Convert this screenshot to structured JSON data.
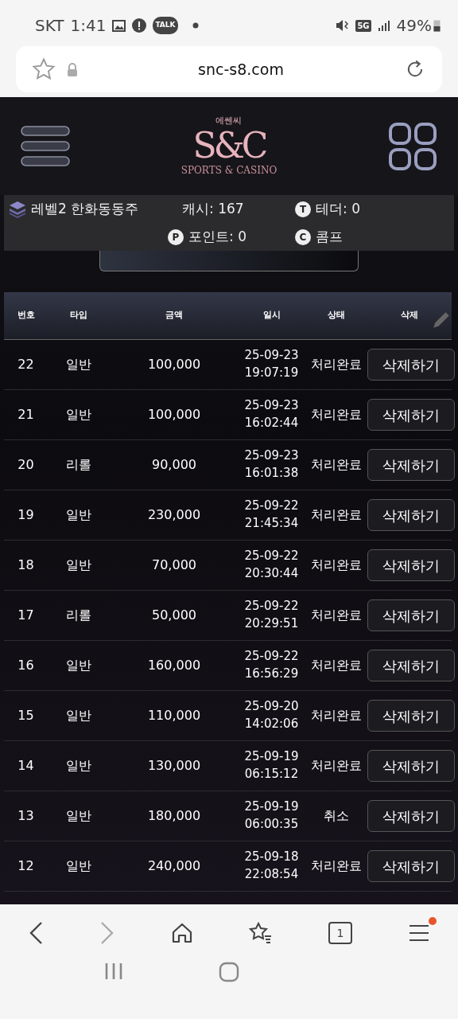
{
  "status_bar": {
    "carrier": "SKT",
    "time": "1:41",
    "talk_badge": "TALK",
    "network": "5G",
    "battery": "49%"
  },
  "address_bar": {
    "url": "snc-s8.com"
  },
  "header": {
    "logo": {
      "monogram": "S&C",
      "korean": "에쎈씨",
      "tagline": "SPORTS & CASINO"
    }
  },
  "user_info": {
    "level": "레벨2 한화동동주",
    "cash": "캐시: 167",
    "tether_badge": "T",
    "tether": "테더: 0",
    "points_badge": "P",
    "points": "포인트: 0",
    "comp_badge": "C",
    "comp": "콤프"
  },
  "table": {
    "columns": [
      "번호",
      "타입",
      "금액",
      "일시",
      "상태",
      "삭제"
    ],
    "rows": [
      {
        "no": "22",
        "type": "일반",
        "amount": "100,000",
        "date": "25-09-23",
        "time": "19:07:19",
        "status": "처리완료",
        "action": "삭제하기"
      },
      {
        "no": "21",
        "type": "일반",
        "amount": "100,000",
        "date": "25-09-23",
        "time": "16:02:44",
        "status": "처리완료",
        "action": "삭제하기"
      },
      {
        "no": "20",
        "type": "리롤",
        "amount": "90,000",
        "date": "25-09-23",
        "time": "16:01:38",
        "status": "처리완료",
        "action": "삭제하기"
      },
      {
        "no": "19",
        "type": "일반",
        "amount": "230,000",
        "date": "25-09-22",
        "time": "21:45:34",
        "status": "처리완료",
        "action": "삭제하기"
      },
      {
        "no": "18",
        "type": "일반",
        "amount": "70,000",
        "date": "25-09-22",
        "time": "20:30:44",
        "status": "처리완료",
        "action": "삭제하기"
      },
      {
        "no": "17",
        "type": "리롤",
        "amount": "50,000",
        "date": "25-09-22",
        "time": "20:29:51",
        "status": "처리완료",
        "action": "삭제하기"
      },
      {
        "no": "16",
        "type": "일반",
        "amount": "160,000",
        "date": "25-09-22",
        "time": "16:56:29",
        "status": "처리완료",
        "action": "삭제하기"
      },
      {
        "no": "15",
        "type": "일반",
        "amount": "110,000",
        "date": "25-09-20",
        "time": "14:02:06",
        "status": "처리완료",
        "action": "삭제하기"
      },
      {
        "no": "14",
        "type": "일반",
        "amount": "130,000",
        "date": "25-09-19",
        "time": "06:15:12",
        "status": "처리완료",
        "action": "삭제하기"
      },
      {
        "no": "13",
        "type": "일반",
        "amount": "180,000",
        "date": "25-09-19",
        "time": "06:00:35",
        "status": "취소",
        "action": "삭제하기"
      },
      {
        "no": "12",
        "type": "일반",
        "amount": "240,000",
        "date": "25-09-18",
        "time": "22:08:54",
        "status": "처리완료",
        "action": "삭제하기"
      }
    ]
  },
  "browser_toolbar": {
    "tab_count": "1",
    "menu_notification": true
  }
}
